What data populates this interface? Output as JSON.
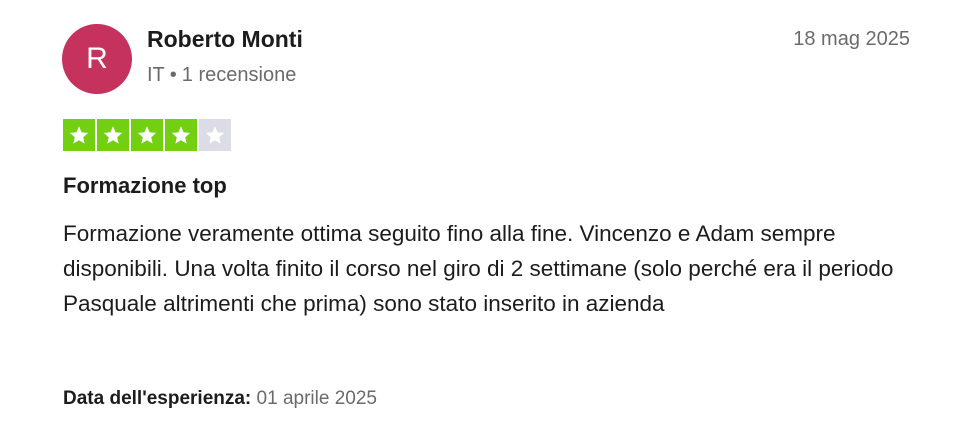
{
  "reviewer": {
    "initial": "R",
    "name": "Roberto Monti",
    "country": "IT",
    "separator": "•",
    "review_count": "1 recensione"
  },
  "review": {
    "date": "18 mag 2025",
    "rating": 4,
    "max_rating": 5,
    "title": "Formazione top",
    "body": "Formazione veramente ottima seguito fino alla fine. Vincenzo e Adam sempre disponibili. Una volta finito il corso nel giro di 2 settimane (solo perché era il periodo Pasquale altrimenti che prima) sono stato inserito in azienda"
  },
  "experience": {
    "label": "Data dell'esperienza:",
    "value": "01 aprile 2025"
  },
  "colors": {
    "avatar_bg": "#c4325d",
    "star_filled": "#73cf11",
    "star_empty": "#dcdce6",
    "muted_text": "#6b6b6b"
  }
}
